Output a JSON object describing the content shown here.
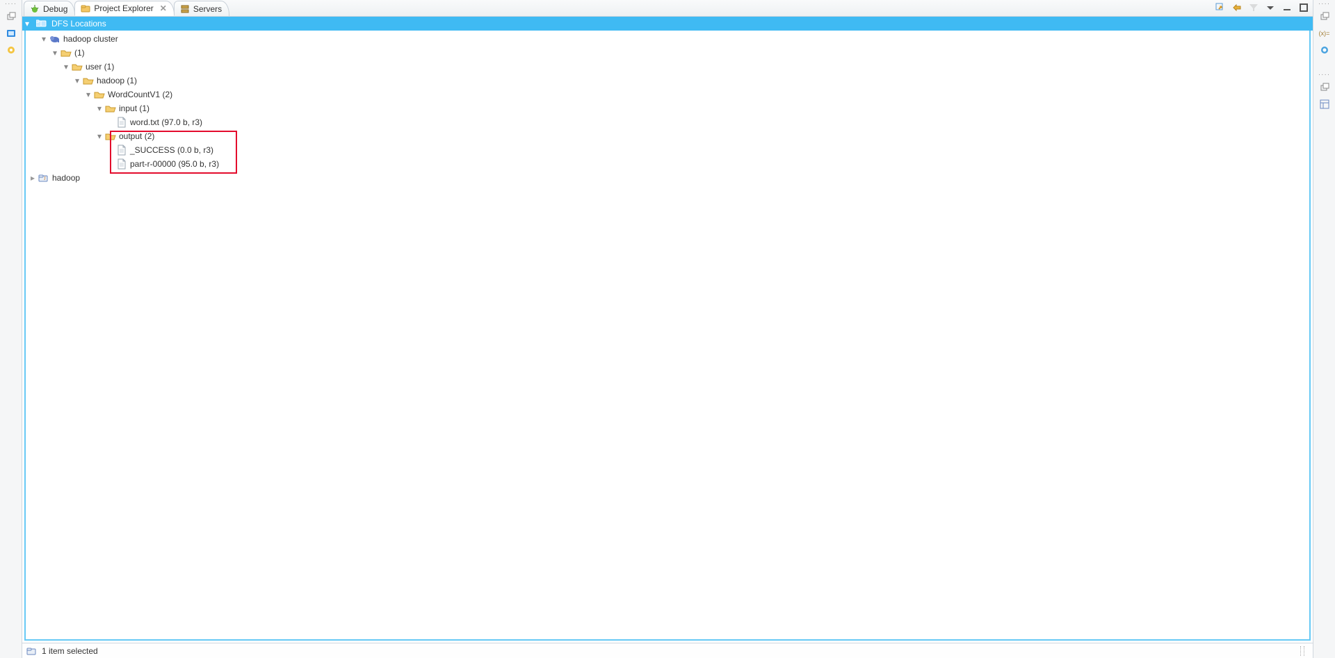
{
  "tabs": {
    "debug": "Debug",
    "projectExplorer": "Project Explorer",
    "servers": "Servers"
  },
  "header": {
    "title": "DFS Locations"
  },
  "tree": {
    "cluster": "hadoop cluster",
    "root": "(1)",
    "user": "user (1)",
    "hadoopDir": "hadoop (1)",
    "wc": "WordCountV1 (2)",
    "input": "input (1)",
    "wordtxt": "word.txt (97.0 b, r3)",
    "output": "output (2)",
    "success": "_SUCCESS (0.0 b, r3)",
    "part": "part-r-00000 (95.0 b, r3)",
    "project": "hadoop"
  },
  "status": {
    "text": "1 item selected"
  },
  "icons": {
    "xvar": "(x)=",
    "circle": "◐"
  }
}
